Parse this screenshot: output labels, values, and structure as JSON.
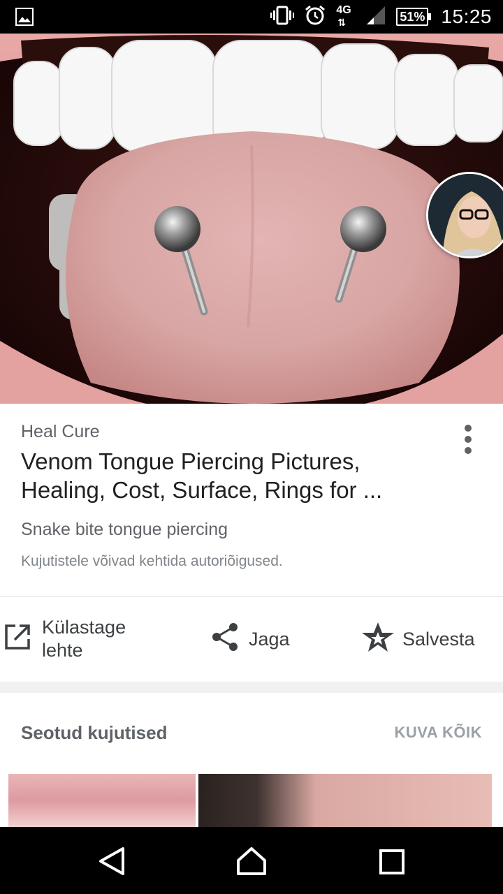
{
  "status_bar": {
    "network": "4G",
    "battery": "51%",
    "time": "15:25"
  },
  "result": {
    "source": "Heal Cure",
    "title": "Venom Tongue Piercing Pictures, Healing, Cost, Surface, Rings for ...",
    "description": "Snake bite tongue piercing",
    "copyright": "Kujutistele võivad kehtida autoriõigused."
  },
  "actions": {
    "visit_label": "Külastage lehte",
    "share_label": "Jaga",
    "save_label": "Salvesta"
  },
  "related": {
    "title": "Seotud kujutised",
    "view_all": "KUVA KÕIK"
  },
  "icons": {
    "status_left": "image-icon",
    "vibrate": "vibrate-icon",
    "alarm": "alarm-icon",
    "signal": "signal-icon",
    "more": "more-vert-icon",
    "visit": "open-in-new-icon",
    "share": "share-icon",
    "save": "star-icon",
    "nav_back": "back-icon",
    "nav_home": "home-icon",
    "nav_recents": "recents-icon"
  },
  "colors": {
    "status_bar": "#000000",
    "title_text": "#202124",
    "secondary_text": "#5f6368",
    "divider": "#e0e0e0"
  }
}
